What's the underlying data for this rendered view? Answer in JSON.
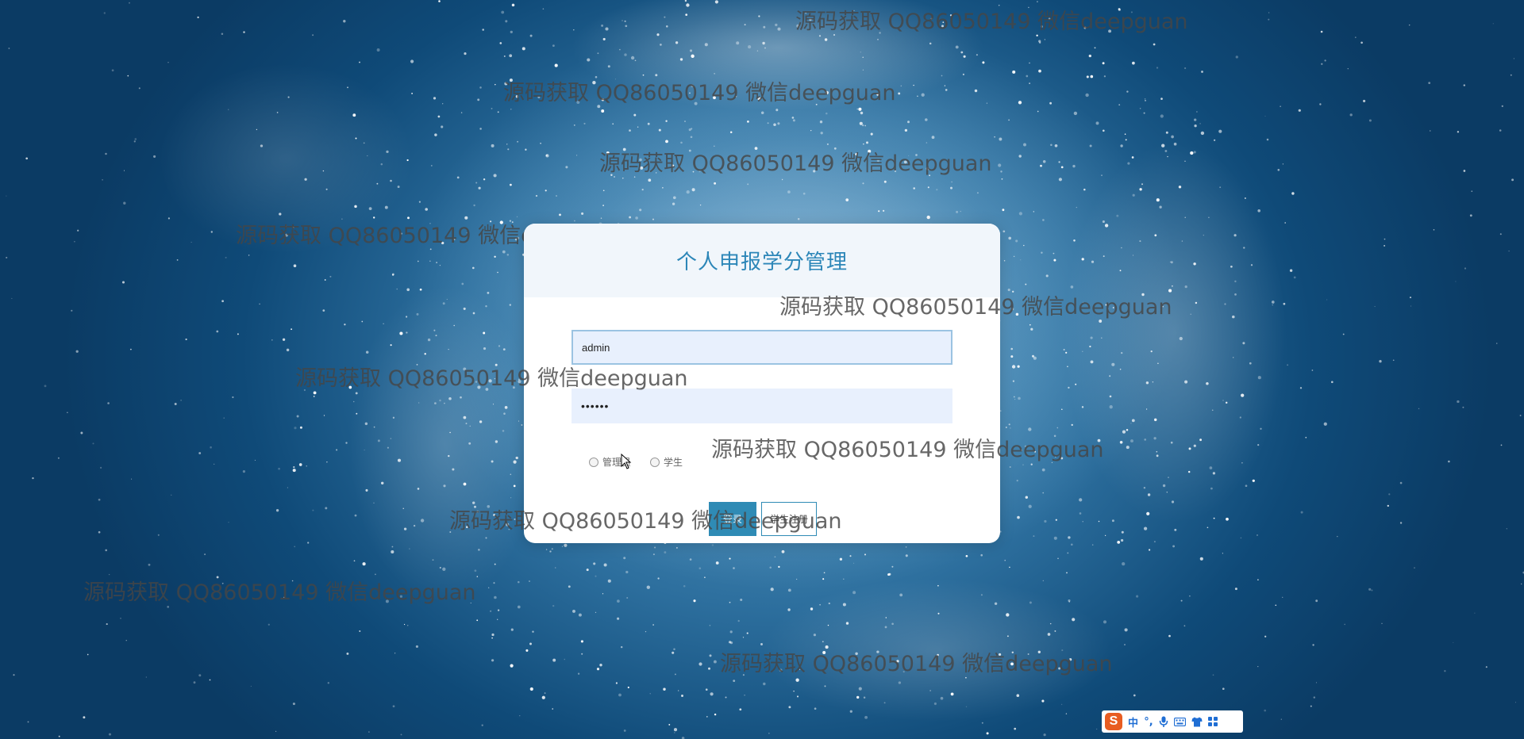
{
  "app": {
    "title": "个人申报学分管理"
  },
  "login": {
    "username_value": "admin",
    "password_value": "••••••",
    "roles": [
      {
        "label": "管理员"
      },
      {
        "label": "学生"
      }
    ],
    "login_button": "登录",
    "register_button": "学生注册"
  },
  "watermark": {
    "text": "源码获取 QQ86050149 微信deepguan"
  },
  "ime_toolbar": {
    "logo": "S",
    "lang": "中",
    "punct": "°,",
    "icons": [
      "microphone-icon",
      "keyboard-icon",
      "shirt-icon",
      "grid-icon"
    ]
  },
  "colors": {
    "accent": "#2f8bb5",
    "title": "#2c86b8",
    "input_bg": "#e8f0fd"
  }
}
